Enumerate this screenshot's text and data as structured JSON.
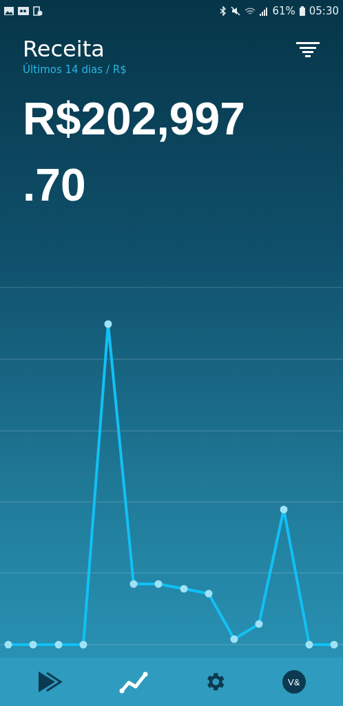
{
  "status_bar": {
    "battery": "61%",
    "time": "05:30"
  },
  "header": {
    "title": "Receita",
    "subtitle": "Últimos 14 dias / R$"
  },
  "total": "R$202,997.70",
  "nav": [
    {
      "kind": "play",
      "selected": false
    },
    {
      "kind": "chart",
      "selected": true
    },
    {
      "kind": "settings",
      "selected": false
    },
    {
      "kind": "avatar",
      "label": "V&",
      "selected": false
    }
  ]
}
